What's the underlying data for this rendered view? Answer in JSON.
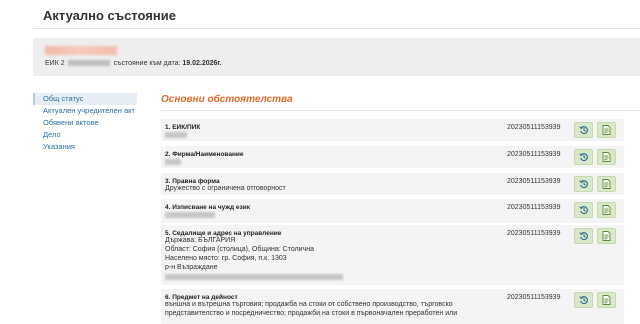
{
  "page": {
    "title": "Актуално състояние"
  },
  "company": {
    "eik_label": "ЕИК 2",
    "status_label": "състояние към дата:",
    "status_date": "19.02.2026г."
  },
  "sidebar": {
    "items": [
      {
        "label": "Общ статус",
        "active": true
      },
      {
        "label": "Актуален учредителен акт"
      },
      {
        "label": "Обявени актове"
      },
      {
        "label": "Дело"
      },
      {
        "label": "Указания"
      }
    ]
  },
  "section": {
    "title": "Основни обстоятелства"
  },
  "rows": [
    {
      "heading": "1. ЕИК/ПИК",
      "number": "20230511153939"
    },
    {
      "heading": "2. Фирма/Наименование",
      "number": "20230511153939"
    },
    {
      "heading": "3. Правна форма",
      "lines": [
        "Дружество с ограничена отговорност"
      ],
      "number": "20230511153939"
    },
    {
      "heading": "4. Изписване на чужд език",
      "number": "20230511153939"
    },
    {
      "heading": "5. Седалище и адрес на управление",
      "lines": [
        "Държава: БЪЛГАРИЯ",
        "Област: София (столица), Община: Столична",
        "Населено място: гр. София, п.к. 1303",
        "р-н Възраждане"
      ],
      "number": "20230511153939"
    },
    {
      "heading": "6. Предмет на дейност",
      "lines": [
        "външна и вътрешна търговия; продажба на стоки от собствено производство, търговско",
        "представителство и посредничество; продажби на стоки в първоначален преработен или"
      ],
      "number": "20230511153939"
    }
  ],
  "icons": {
    "history": "history-icon",
    "document": "document-icon"
  },
  "colors": {
    "accent": "#e06a2c",
    "link": "#2e6ea6",
    "button": "#d9e8c9"
  }
}
